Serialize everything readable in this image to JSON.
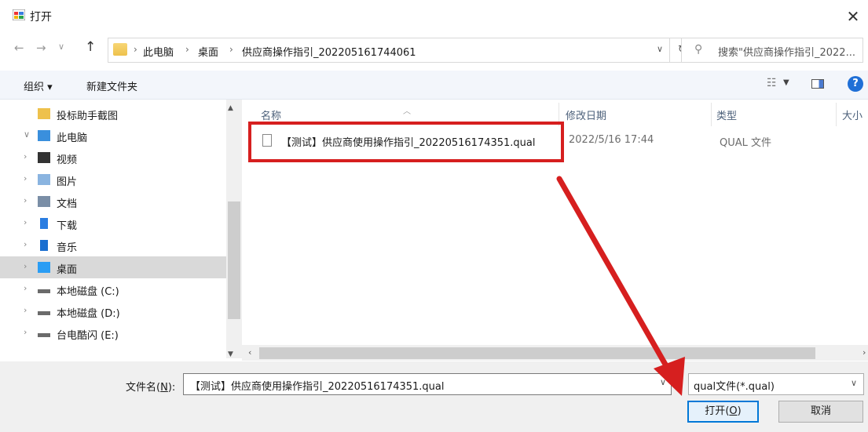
{
  "window": {
    "title": "打开",
    "close_glyph": "✕"
  },
  "address": {
    "crumbs": [
      "此电脑",
      "桌面",
      "供应商操作指引_202205161744061"
    ],
    "separator": "›"
  },
  "search": {
    "placeholder": "搜索\"供应商操作指引_2022..."
  },
  "toolbar": {
    "organize_label": "组织 ▾",
    "new_folder_label": "新建文件夹",
    "help_glyph": "?"
  },
  "nav": {
    "items": [
      {
        "label": "投标助手截图",
        "icon": "folder-icon",
        "expander": ""
      },
      {
        "label": "此电脑",
        "icon": "computer-icon",
        "expander": "∨"
      },
      {
        "label": "视频",
        "icon": "video-icon",
        "expander": "›"
      },
      {
        "label": "图片",
        "icon": "pictures-icon",
        "expander": "›"
      },
      {
        "label": "文档",
        "icon": "documents-icon",
        "expander": "›"
      },
      {
        "label": "下载",
        "icon": "download-icon",
        "expander": "›"
      },
      {
        "label": "音乐",
        "icon": "music-icon",
        "expander": "›"
      },
      {
        "label": "桌面",
        "icon": "desktop-icon",
        "expander": "›"
      },
      {
        "label": "本地磁盘 (C:)",
        "icon": "drive-icon",
        "expander": "›"
      },
      {
        "label": "本地磁盘 (D:)",
        "icon": "drive-icon",
        "expander": "›"
      },
      {
        "label": "台电酷闪 (E:)",
        "icon": "drive-icon",
        "expander": "›"
      }
    ],
    "selected_index": 7
  },
  "columns": {
    "name": "名称",
    "date": "修改日期",
    "type": "类型",
    "size": "大小"
  },
  "files": [
    {
      "name": "【测试】供应商使用操作指引_20220516174351.qual",
      "date": "2022/5/16 17:44",
      "type": "QUAL 文件"
    }
  ],
  "bottom": {
    "filename_label": "文件名",
    "filename_accel": "N",
    "filename_value": "【测试】供应商使用操作指引_20220516174351.qual",
    "filter_value": "qual文件(*.qual)",
    "open_label": "打开",
    "open_accel": "O",
    "cancel_label": "取消"
  },
  "annotation": {
    "color": "#d61f1f"
  }
}
